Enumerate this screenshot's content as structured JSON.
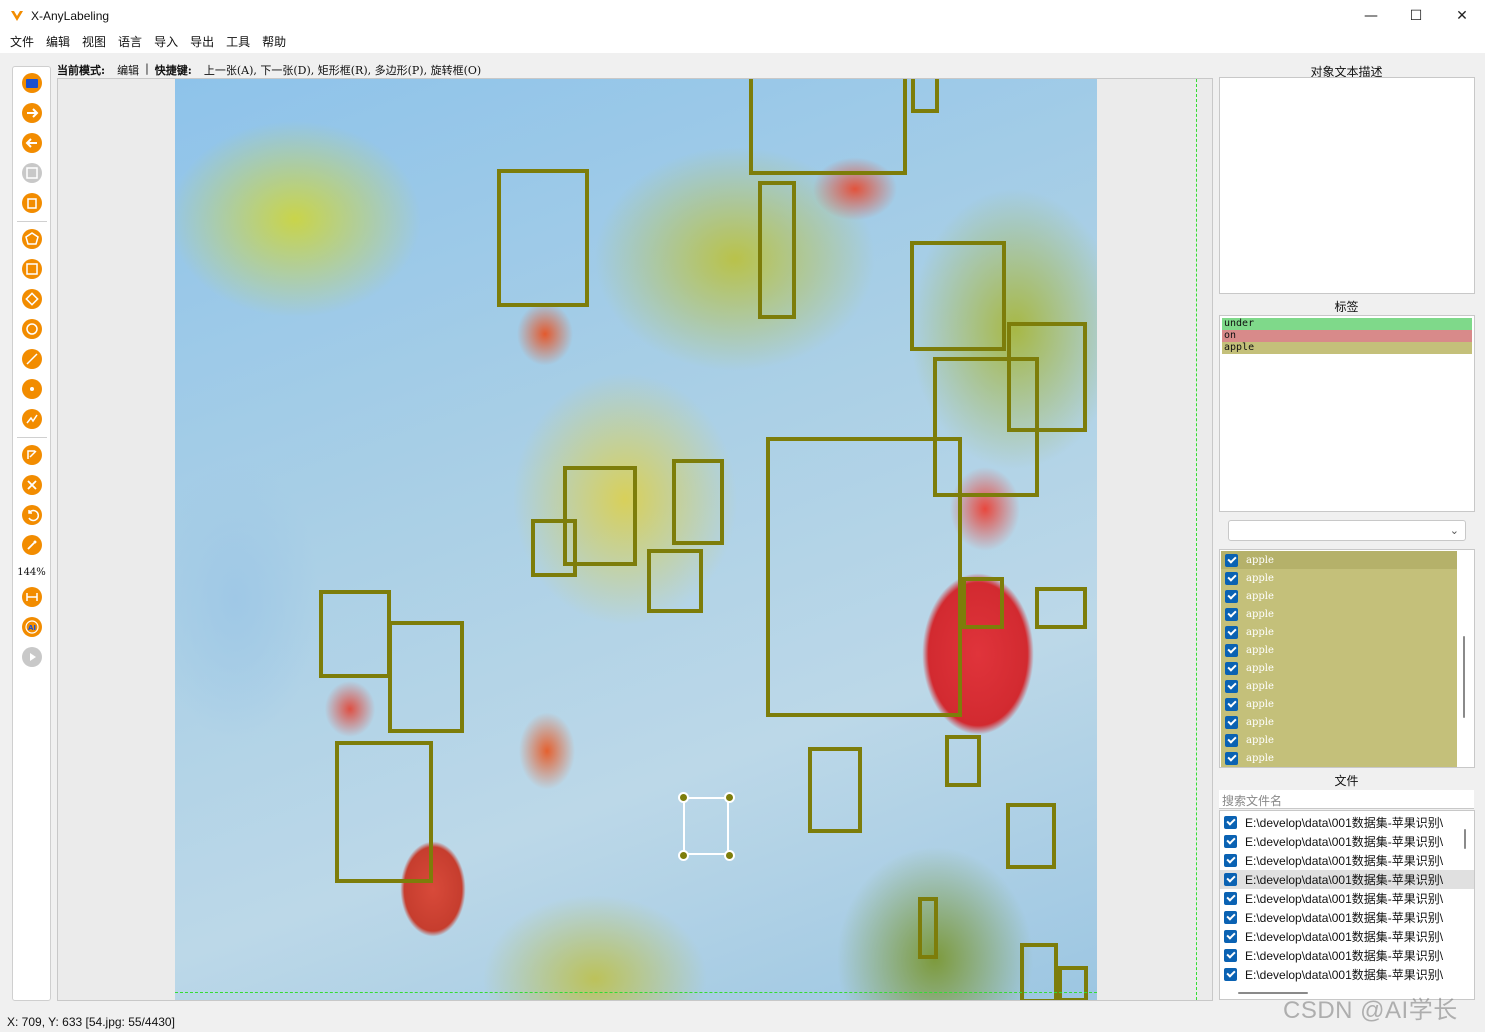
{
  "window": {
    "title": "X-AnyLabeling",
    "controls": [
      "—",
      "☐",
      "✕"
    ]
  },
  "menu": [
    "文件",
    "编辑",
    "视图",
    "语言",
    "导入",
    "导出",
    "工具",
    "帮助"
  ],
  "mode_line": {
    "mode_label": "当前模式:",
    "mode_value": "编辑",
    "sep": "|",
    "shortcut_label": "快捷键:",
    "shortcuts": "上一张(A), 下一张(D), 矩形框(R), 多边形(P), 旋转框(O)"
  },
  "toolbar": {
    "zoom": "144%",
    "icons": [
      "open-folder-icon",
      "next-image-icon",
      "prev-image-icon",
      "save-icon",
      "delete-icon",
      "polygon-icon",
      "rectangle-icon",
      "rotation-icon",
      "circle-icon",
      "line-icon",
      "point-icon",
      "linestrip-icon",
      "edit-icon",
      "delete-shape-icon",
      "undo-icon",
      "brush-icon",
      "fit-width-icon",
      "ai-icon",
      "play-icon"
    ]
  },
  "right_panel": {
    "description_title": "对象文本描述",
    "labels_title": "标签",
    "labels": [
      {
        "text": "under",
        "color": "#7fd98a"
      },
      {
        "text": "on",
        "color": "#d88a8a"
      },
      {
        "text": "apple",
        "color": "#c4c07a"
      }
    ],
    "shapes": [
      "apple",
      "apple",
      "apple",
      "apple",
      "apple",
      "apple",
      "apple",
      "apple",
      "apple",
      "apple",
      "apple",
      "apple"
    ],
    "files_title": "文件",
    "search_placeholder": "搜索文件名",
    "files": [
      "E:\\develop\\data\\001数据集-苹果识别\\",
      "E:\\develop\\data\\001数据集-苹果识别\\",
      "E:\\develop\\data\\001数据集-苹果识别\\",
      "E:\\develop\\data\\001数据集-苹果识别\\",
      "E:\\develop\\data\\001数据集-苹果识别\\",
      "E:\\develop\\data\\001数据集-苹果识别\\",
      "E:\\develop\\data\\001数据集-苹果识别\\",
      "E:\\develop\\data\\001数据集-苹果识别\\",
      "E:\\develop\\data\\001数据集-苹果识别\\"
    ],
    "selected_file_index": 3
  },
  "status_bar": "X: 709, Y: 633 [54.jpg: 55/4430]",
  "watermark": "CSDN @AI学长",
  "colors": {
    "accent": "#f28c00",
    "bbox": "#7d7d0a",
    "checkbox": "#0a62b3"
  }
}
